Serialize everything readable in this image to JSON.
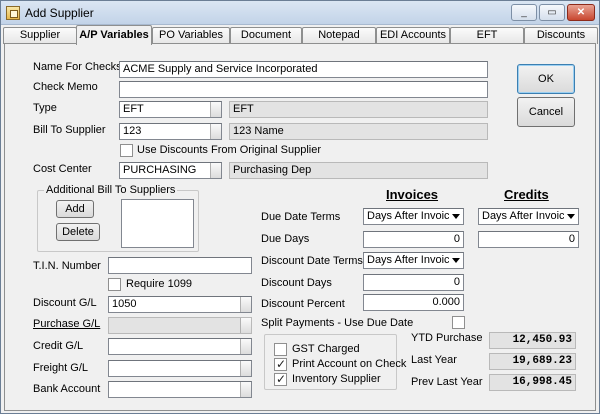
{
  "window": {
    "title": "Add Supplier",
    "icon": "app-icon",
    "minimize": "_",
    "maximize": "▭",
    "close": "✕"
  },
  "tabs": [
    "Supplier",
    "A/P Variables",
    "PO Variables",
    "Document",
    "Notepad",
    "EDI Accounts",
    "EFT",
    "Discounts"
  ],
  "active_tab": "A/P Variables",
  "form": {
    "name_for_checks_label": "Name For Checks",
    "name_for_checks_value": "ACME Supply and Service Incorporated",
    "check_memo_label": "Check Memo",
    "check_memo_value": "",
    "type_label": "Type",
    "type_code": "EFT",
    "type_desc": "EFT",
    "bill_to_label": "Bill To Supplier",
    "bill_to_code": "123",
    "bill_to_desc": "123 Name",
    "use_discounts_label": "Use Discounts From Original Supplier",
    "cost_center_label": "Cost Center",
    "cost_center_code": "PURCHASING",
    "cost_center_desc": "Purchasing Dep",
    "additional_bill_to_label": "Additional Bill To Suppliers",
    "add_label": "Add",
    "delete_label": "Delete",
    "tin_label": "T.I.N. Number",
    "tin_value": "",
    "require_1099_label": "Require 1099",
    "discount_gl_label": "Discount G/L",
    "discount_gl_value": "1050",
    "purchase_gl_label": "Purchase G/L",
    "credit_gl_label": "Credit G/L",
    "freight_gl_label": "Freight G/L",
    "bank_account_label": "Bank Account"
  },
  "terms": {
    "invoices_heading": "Invoices",
    "credits_heading": "Credits",
    "due_date_terms_label": "Due Date Terms",
    "due_date_terms_invoice": "Days After Invoice",
    "due_date_terms_credit": "Days After Invoice",
    "due_days_label": "Due Days",
    "due_days_invoice": "0",
    "due_days_credit": "0",
    "discount_date_terms_label": "Discount Date Terms",
    "discount_date_terms_invoice": "Days After Invoice",
    "discount_days_label": "Discount Days",
    "discount_days_invoice": "0",
    "discount_percent_label": "Discount Percent",
    "discount_percent_invoice": "0.000",
    "split_payments_label": "Split Payments - Use Due Date"
  },
  "flags": {
    "gst_charged_label": "GST Charged",
    "gst_charged": false,
    "print_account_label": "Print Account on Check",
    "print_account": true,
    "inventory_supplier_label": "Inventory Supplier",
    "inventory_supplier": true
  },
  "totals": {
    "ytd_label": "YTD Purchase",
    "ytd_value": "12,450.93",
    "last_year_label": "Last Year",
    "last_year_value": "19,689.23",
    "prev_last_year_label": "Prev Last Year",
    "prev_last_year_value": "16,998.45"
  },
  "buttons": {
    "ok": "OK",
    "cancel": "Cancel"
  }
}
